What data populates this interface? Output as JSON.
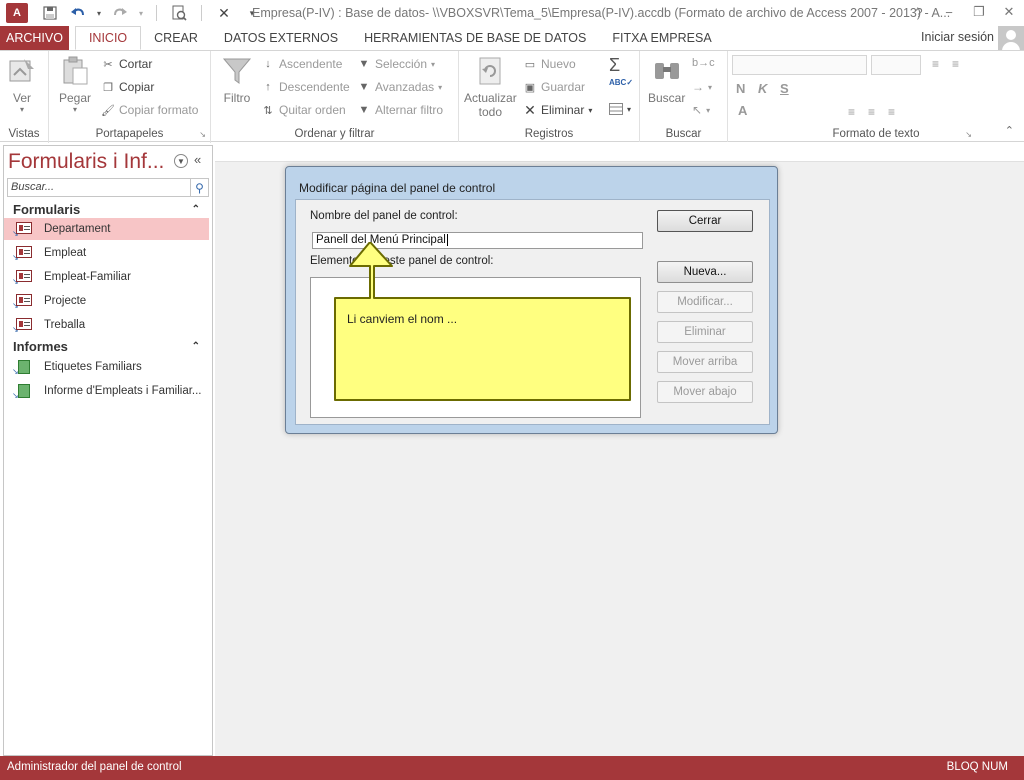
{
  "window": {
    "app_icon": "A",
    "title": "Empresa(P-IV) : Base de datos- \\\\VBOXSVR\\Tema_5\\Empresa(P-IV).accdb (Formato de archivo de Access 2007 - 2013) - A...",
    "controls": [
      "?",
      "−",
      "❐",
      "✕"
    ]
  },
  "ribbon_tabs": [
    "ARCHIVO",
    "INICIO",
    "CREAR",
    "DATOS EXTERNOS",
    "HERRAMIENTAS DE BASE DE DATOS",
    "FITXA EMPRESA"
  ],
  "signin": "Iniciar sesión",
  "ribbon": {
    "vistas": {
      "label": "Vistas",
      "ver": "Ver"
    },
    "portapapeles": {
      "label": "Portapapeles",
      "pegar": "Pegar",
      "cortar": "Cortar",
      "copiar": "Copiar",
      "copiar_formato": "Copiar formato"
    },
    "ordenar": {
      "label": "Ordenar y filtrar",
      "filtro": "Filtro",
      "ascendente": "Ascendente",
      "descendente": "Descendente",
      "quitar_orden": "Quitar orden",
      "seleccion": "Selección",
      "avanzadas": "Avanzadas",
      "alternar_filtro": "Alternar filtro"
    },
    "registros": {
      "label": "Registros",
      "actualizar": "Actualizar",
      "todo": "todo",
      "nuevo": "Nuevo",
      "guardar": "Guardar",
      "eliminar": "Eliminar"
    },
    "buscar": {
      "label": "Buscar",
      "buscar": "Buscar"
    },
    "formato": {
      "label": "Formato de texto",
      "bold": "N",
      "italic": "K",
      "underline": "S",
      "color": "A"
    }
  },
  "navpane": {
    "title": "Formularis i Inf...",
    "search_placeholder": "Buscar...",
    "sections": [
      {
        "name": "Formularis",
        "items": [
          "Departament",
          "Empleat",
          "Empleat-Familiar",
          "Projecte",
          "Treballa"
        ]
      },
      {
        "name": "Informes",
        "items": [
          "Etiquetes Familiars",
          "Informe d'Empleats i Familiar..."
        ]
      }
    ]
  },
  "dialog": {
    "title": "Modificar página del panel de control",
    "name_label": "Nombre del panel de control:",
    "name_value": "Panell del Menú Principal",
    "items_label": "Elementos de este panel de control:",
    "buttons": {
      "cerrar": "Cerrar",
      "nueva": "Nueva...",
      "modificar": "Modificar...",
      "eliminar": "Eliminar",
      "arriba": "Mover arriba",
      "abajo": "Mover abajo"
    }
  },
  "callout": {
    "text": "Li canviem el nom ..."
  },
  "statusbar": {
    "left": "Administrador del panel de control",
    "right": "BLOQ NUM"
  },
  "colors": {
    "accent": "#a4373a",
    "callout_fill": "#ffff80",
    "callout_stroke": "#6b6b00",
    "dialog_frame": "#bcd3ea"
  }
}
